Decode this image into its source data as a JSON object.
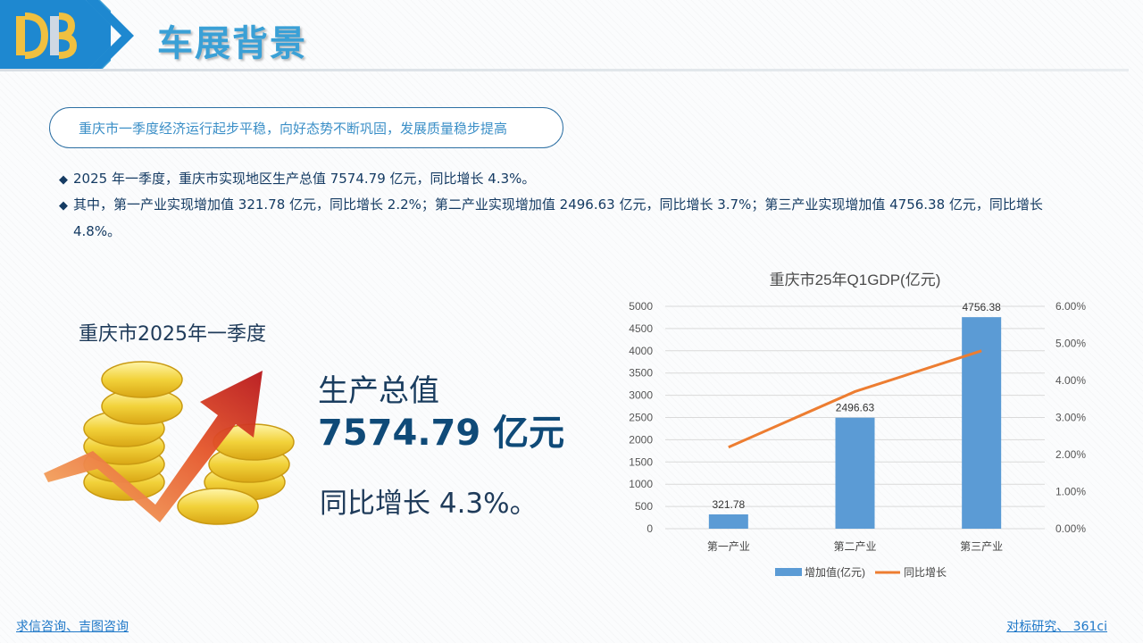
{
  "header": {
    "title": "车展背景",
    "colors": {
      "accent": "#3aa0d6",
      "navy": "#0f4a78"
    }
  },
  "summary_pill": "重庆市一季度经济运行起步平稳，向好态势不断巩固，发展质量稳步提高",
  "bullets": [
    {
      "marker": "◆",
      "text": "2025 年一季度，重庆市实现地区生产总值 7574.79 亿元，同比增长 4.3%。"
    },
    {
      "marker": "◆",
      "text": "其中，第一产业实现增加值 321.78 亿元，同比增长 2.2%；第二产业实现增加值 2496.63 亿元，同比增长 3.7%；第三产业实现增加值 4756.38 亿元，同比增长",
      "continuation": "4.8%。"
    }
  ],
  "kpi": {
    "heading": "重庆市2025年一季度",
    "label": "生产总值",
    "value": "7574.79 亿元",
    "growth": "同比增长 4.3%。",
    "icon": "gold-coins-rising-arrow-icon"
  },
  "chart_data": {
    "type": "bar",
    "title": "重庆市25年Q1GDP(亿元)",
    "categories": [
      "第一产业",
      "第二产业",
      "第三产业"
    ],
    "series": [
      {
        "name": "增加值(亿元)",
        "kind": "bar",
        "axis": "left",
        "values": [
          321.78,
          2496.63,
          4756.38
        ],
        "labels": [
          "321.78",
          "2496.63",
          "4756.38"
        ],
        "color": "#5b9bd5"
      },
      {
        "name": "同比增长",
        "kind": "line",
        "axis": "right",
        "values": [
          0.022,
          0.037,
          0.048
        ],
        "color": "#ed7d31"
      }
    ],
    "y_left": {
      "min": 0,
      "max": 5000,
      "step": 500,
      "ticks": [
        "0",
        "500",
        "1000",
        "1500",
        "2000",
        "2500",
        "3000",
        "3500",
        "4000",
        "4500",
        "5000"
      ]
    },
    "y_right": {
      "min": 0,
      "max": 0.06,
      "step": 0.01,
      "ticks": [
        "0.00%",
        "1.00%",
        "2.00%",
        "3.00%",
        "4.00%",
        "5.00%",
        "6.00%"
      ]
    },
    "grid": true,
    "legend_position": "bottom"
  },
  "footer": {
    "left": "求信咨询、吉图咨询",
    "right": "对标研究、 361ci"
  }
}
